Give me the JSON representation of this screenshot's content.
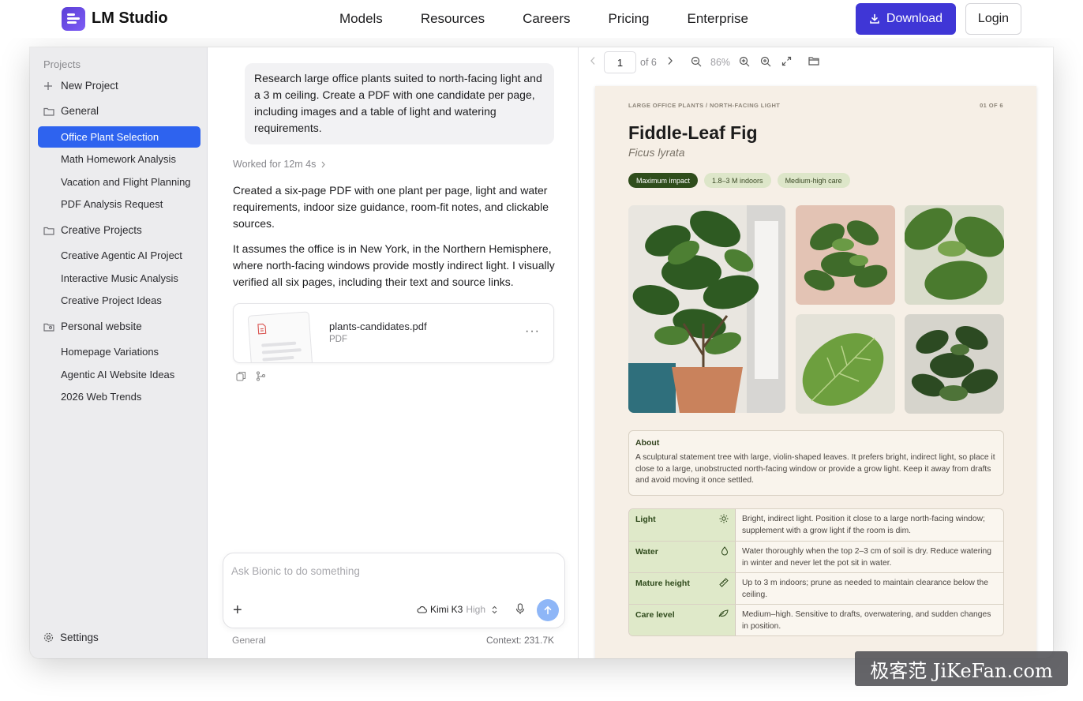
{
  "site": {
    "brand": "LM Studio",
    "nav": [
      "Models",
      "Resources",
      "Careers",
      "Pricing",
      "Enterprise"
    ],
    "download_label": "Download",
    "login_label": "Login",
    "accent": "#3f36d6"
  },
  "sidebar": {
    "section_label": "Projects",
    "new_project": "New Project",
    "groups": [
      {
        "label": "General",
        "items": [
          "Office Plant Selection",
          "Math Homework Analysis",
          "Vacation and Flight Planning",
          "PDF Analysis Request"
        ]
      },
      {
        "label": "Creative Projects",
        "items": [
          "Creative Agentic AI Project",
          "Interactive Music Analysis",
          "Creative Project Ideas"
        ]
      },
      {
        "label": "Personal website",
        "items": [
          "Homepage Variations",
          "Agentic AI Website Ideas",
          "2026 Web Trends"
        ]
      }
    ],
    "active_item": "Office Plant Selection",
    "settings_label": "Settings"
  },
  "chat": {
    "user_message": "Research large office plants suited to north-facing light and a 3 m ceiling. Create a PDF with one candidate per page, including images and a table of light and watering requirements.",
    "worked_label": "Worked for 12m 4s",
    "reply_1": "Created a six-page PDF with one plant per page, light and water requirements, indoor size guidance, room-fit notes, and clickable sources.",
    "reply_2": "It assumes the office is in New York, in the Northern Hemisphere, where north-facing windows provide mostly indirect light. I visually verified all six pages, including their text and source links.",
    "file": {
      "name": "plants-candidates.pdf",
      "type": "PDF"
    },
    "composer_placeholder": "Ask Bionic to do something",
    "model_name": "Kimi K3",
    "model_level": "High",
    "footer_project": "General",
    "footer_context": "Context: 231.7K"
  },
  "viewer": {
    "page_value": "1",
    "page_total": "of 6",
    "zoom": "86%",
    "page": {
      "kicker": "LARGE OFFICE PLANTS / NORTH-FACING LIGHT",
      "page_label": "01 OF 6",
      "title": "Fiddle-Leaf Fig",
      "latin": "Ficus lyrata",
      "tags": [
        "Maximum impact",
        "1.8–3 M indoors",
        "Medium-high care"
      ],
      "about_heading": "About",
      "about_text": "A sculptural statement tree with large, violin-shaped leaves. It prefers bright, indirect light, so place it close to a large, unobstructed north-facing window or provide a grow light. Keep it away from drafts and avoid moving it once settled.",
      "care": [
        {
          "key": "Light",
          "icon": "sun-icon",
          "value": "Bright, indirect light. Position it close to a large north-facing window; supplement with a grow light if the room is dim."
        },
        {
          "key": "Water",
          "icon": "droplet-icon",
          "value": "Water thoroughly when the top 2–3 cm of soil is dry. Reduce watering in winter and never let the pot sit in water."
        },
        {
          "key": "Mature height",
          "icon": "ruler-icon",
          "value": "Up to 3 m indoors; prune as needed to maintain clearance below the ceiling."
        },
        {
          "key": "Care level",
          "icon": "leaf-icon",
          "value": "Medium–high. Sensitive to drafts, overwatering, and sudden changes in position."
        }
      ]
    }
  },
  "watermark": "极客范 JiKeFan.com"
}
